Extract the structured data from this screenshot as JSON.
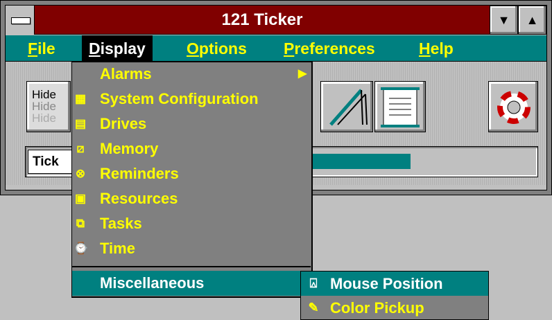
{
  "window": {
    "title": "121 Ticker",
    "scroll_down_icon": "▼",
    "scroll_up_icon": "▲"
  },
  "menubar": [
    {
      "label": "File",
      "hotkey": "F",
      "rest": "ile"
    },
    {
      "label": "Display",
      "hotkey": "D",
      "rest": "isplay"
    },
    {
      "label": "Options",
      "hotkey": "O",
      "rest": "ptions"
    },
    {
      "label": "Preferences",
      "hotkey": "P",
      "rest": "references"
    },
    {
      "label": "Help",
      "hotkey": "H",
      "rest": "elp"
    }
  ],
  "toolbar": {
    "hide_button": {
      "line1": "Hide",
      "line2": "Hide",
      "line3": "Hide"
    },
    "ticker_label": "Tick"
  },
  "display_menu": {
    "items": [
      {
        "label": "Alarms",
        "icon": "",
        "submenu_arrow": "▶"
      },
      {
        "label": "System Configuration",
        "icon": "system-config-icon"
      },
      {
        "label": "Drives",
        "icon": "drive-icon"
      },
      {
        "label": "Memory",
        "icon": "memory-icon"
      },
      {
        "label": "Reminders",
        "icon": "reminder-icon"
      },
      {
        "label": "Resources",
        "icon": "resources-icon"
      },
      {
        "label": "Tasks",
        "icon": "tasks-icon"
      },
      {
        "label": "Time",
        "icon": "clock-icon"
      }
    ],
    "selected": "Miscellaneous"
  },
  "misc_submenu": {
    "items": [
      {
        "label": "Mouse Position",
        "icon": "mouse-icon",
        "selected": true
      },
      {
        "label": "Color Pickup",
        "icon": "eyedropper-icon",
        "selected": false
      }
    ]
  },
  "colors": {
    "titlebar": "#800000",
    "menubar": "#008080",
    "menu_text": "#ffff00",
    "highlight": "#008080"
  }
}
